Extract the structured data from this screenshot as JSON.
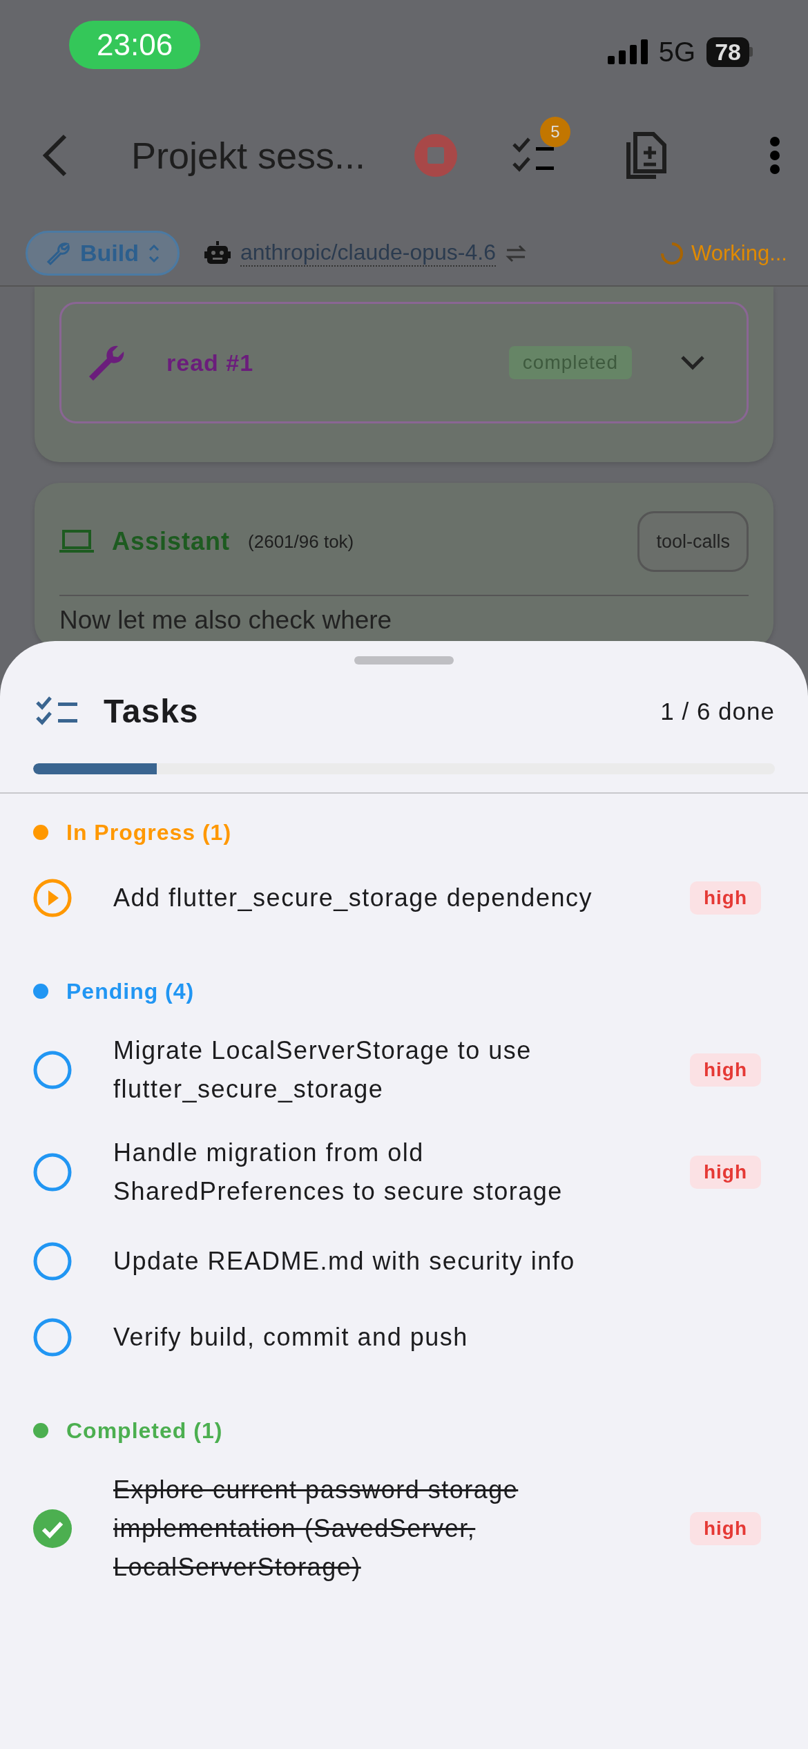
{
  "status_bar": {
    "time": "23:06",
    "network": "5G",
    "battery": "78"
  },
  "app_bar": {
    "title": "Projekt sess...",
    "task_badge": "5"
  },
  "toolbar": {
    "mode": "Build",
    "model": "anthropic/claude-opus-4.6",
    "status": "Working..."
  },
  "messages": [
    {
      "kind": "tool",
      "name": "read #1",
      "status": "completed"
    },
    {
      "kind": "assistant",
      "role": "Assistant",
      "tokens": "(2601/96 tok)",
      "finish": "tool-calls",
      "text": "Now let me also check where"
    }
  ],
  "tasks_sheet": {
    "title": "Tasks",
    "summary": "1 / 6 done",
    "level": 0.167,
    "groups": [
      {
        "kind": "in_progress",
        "label": "In Progress (1)",
        "color": "#ff9800",
        "tasks": [
          {
            "text": "Add flutter_secure_storage dependency",
            "priority": "high"
          }
        ]
      },
      {
        "kind": "pending",
        "label": "Pending (4)",
        "color": "#2196f3",
        "tasks": [
          {
            "text": "Migrate LocalServerStorage to use flutter_secure_storage",
            "priority": "high"
          },
          {
            "text": "Handle migration from old SharedPreferences to secure storage",
            "priority": "high"
          },
          {
            "text": "Update README.md with security info"
          },
          {
            "text": "Verify build, commit and push"
          }
        ]
      },
      {
        "kind": "completed",
        "label": "Completed (1)",
        "color": "#4caf50",
        "tasks": [
          {
            "text": "Explore current password storage implementation (SavedServer, LocalServerStorage)",
            "priority": "high"
          }
        ]
      }
    ]
  }
}
